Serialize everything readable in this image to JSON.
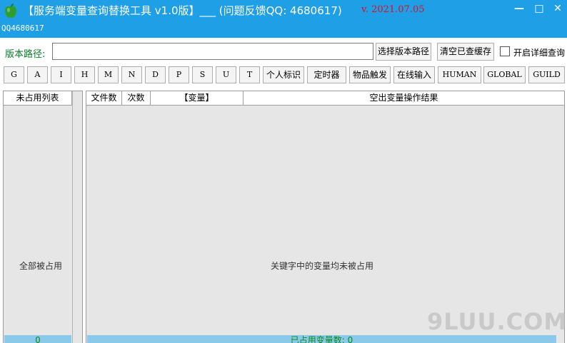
{
  "window": {
    "title": "【服务端变量查询替换工具 v1.0版】___ (问题反馈QQ: 4680617)",
    "date": "v. 2021.07.05",
    "subtitle": "QQ4680617",
    "minimize": "—",
    "maximize": "□",
    "close": "✕",
    "icon": "apple-icon",
    "accent": "#1f9fe5"
  },
  "toolbar": {
    "path_label": "版本路径:",
    "path_value": "",
    "select_button": "选择版本路径",
    "clear_button": "清空已查缓存",
    "detail_checkbox_label": "开启详细查询",
    "detail_checked": false
  },
  "filters": [
    {
      "label": "G"
    },
    {
      "label": "A"
    },
    {
      "label": "I"
    },
    {
      "label": "H"
    },
    {
      "label": "M"
    },
    {
      "label": "N"
    },
    {
      "label": "D"
    },
    {
      "label": "P"
    },
    {
      "label": "S"
    },
    {
      "label": "U"
    },
    {
      "label": "T"
    },
    {
      "label": "个人标识"
    },
    {
      "label": "定时器"
    },
    {
      "label": "物品触发"
    },
    {
      "label": "在线输入"
    },
    {
      "label": "HUMAN"
    },
    {
      "label": "GLOBAL"
    },
    {
      "label": "GUILD"
    }
  ],
  "left_panel": {
    "header": "未占用列表",
    "empty_message": "全部被占用",
    "count": "0"
  },
  "right_panel": {
    "columns": [
      "文件数",
      "次数",
      "【变量】",
      "空出变量操作结果"
    ],
    "empty_message": "关键字中的变量均未被占用",
    "status": "已占用变量数: 0"
  },
  "watermark": "9LUU.COM"
}
